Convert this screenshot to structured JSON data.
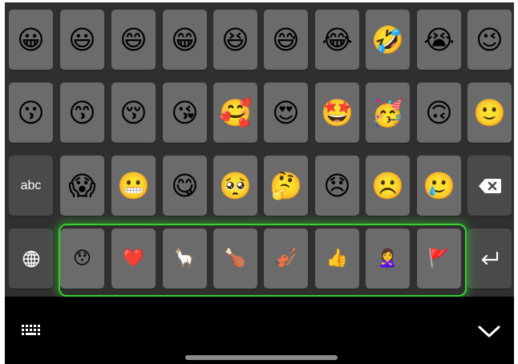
{
  "keyboard": {
    "rows": [
      [
        "😀",
        "😃",
        "😄",
        "😁",
        "😆",
        "😅",
        "😂",
        "🤣",
        "😭",
        "😉"
      ],
      [
        "😗",
        "😙",
        "😚",
        "😘",
        "🥰",
        "😍",
        "🤩",
        "🥳",
        "🙃",
        "🙂"
      ],
      [
        "😱",
        "😬",
        "😋",
        "🥺",
        "🤔",
        "😞",
        "☹️",
        "🥲"
      ]
    ],
    "abc_label": "abc",
    "suggestions": [
      "😯",
      "❤️",
      "🦙",
      "🍗",
      "🎻",
      "👍",
      "🙎‍♀️",
      "🚩"
    ]
  },
  "icons": {
    "backspace": "backspace-icon",
    "globe": "globe-icon",
    "return": "return-icon",
    "keyboard_toggle": "keyboard-icon",
    "dismiss": "chevron-down-icon"
  },
  "colors": {
    "keyboard_bg": "#2f2f2f",
    "key_bg": "#6b6b6b",
    "function_key_bg": "#4a4a4a",
    "suggestion_highlight": "#34d12f",
    "bottom_bar_bg": "#000000"
  }
}
